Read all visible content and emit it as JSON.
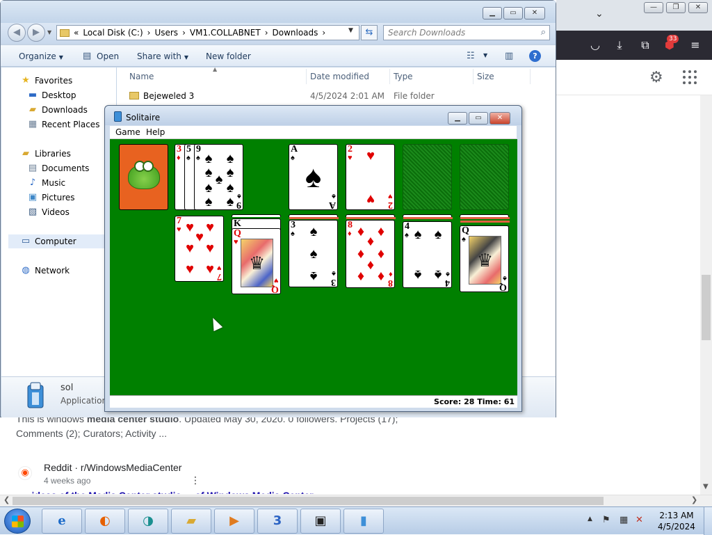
{
  "browser": {
    "snippet_prefix": "This is windows ",
    "snippet_bold": "media center studio",
    "snippet_rest": ". Updated May 30, 2020. 0 followers. Projects (17);",
    "snippet_line2": "Comments (2); Curators; Activity ...",
    "reddit_name": "Reddit · r/WindowsMediaCenter",
    "reddit_date": "4 weeks ago",
    "extension_badge": "33",
    "cut_link": "... ideas of the Media Center studio ... of Windows Media Center"
  },
  "explorer": {
    "address": [
      "«",
      "Local Disk (C:)",
      "›",
      "Users",
      "›",
      "VM1.COLLABNET",
      "›",
      "Downloads",
      "›"
    ],
    "search_placeholder": "Search Downloads",
    "toolbar": {
      "organize": "Organize",
      "open": "Open",
      "share_with": "Share with",
      "new_folder": "New folder"
    },
    "nav": {
      "favorites": "Favorites",
      "desktop": "Desktop",
      "downloads": "Downloads",
      "recent_places": "Recent Places",
      "libraries": "Libraries",
      "documents": "Documents",
      "music": "Music",
      "pictures": "Pictures",
      "videos": "Videos",
      "computer": "Computer",
      "network": "Network"
    },
    "columns": {
      "name": "Name",
      "date_modified": "Date modified",
      "type": "Type",
      "size": "Size"
    },
    "rows": [
      {
        "name": "Bejeweled 3",
        "date": "4/5/2024 2:01 AM",
        "type": "File folder",
        "size": ""
      }
    ],
    "details": {
      "name": "sol",
      "type": "Application"
    }
  },
  "solitaire": {
    "title": "Solitaire",
    "menu": {
      "game": "Game",
      "help": "Help"
    },
    "status": "Score: 28 Time: 61",
    "waste": [
      {
        "rank": "3",
        "suit": "♦",
        "color": "red"
      },
      {
        "rank": "5",
        "suit": "♠",
        "color": "black"
      },
      {
        "rank": "9",
        "suit": "♠",
        "color": "black"
      }
    ],
    "foundations": [
      {
        "rank": "A",
        "suit": "♠",
        "color": "black"
      },
      {
        "rank": "2",
        "suit": "♥",
        "color": "red"
      }
    ],
    "tableau": [
      {
        "rank": "7",
        "suit": "♥",
        "color": "red"
      },
      {
        "rank": "Q",
        "suit": "♥",
        "color": "red",
        "under": "K"
      },
      {
        "rank": "3",
        "suit": "♠",
        "color": "black"
      },
      {
        "rank": "8",
        "suit": "♦",
        "color": "red"
      },
      {
        "rank": "4",
        "suit": "♠",
        "color": "black"
      },
      {
        "rank": "Q",
        "suit": "♠",
        "color": "black"
      }
    ]
  },
  "taskbar": {
    "clock_time": "2:13 AM",
    "clock_date": "4/5/2024"
  }
}
